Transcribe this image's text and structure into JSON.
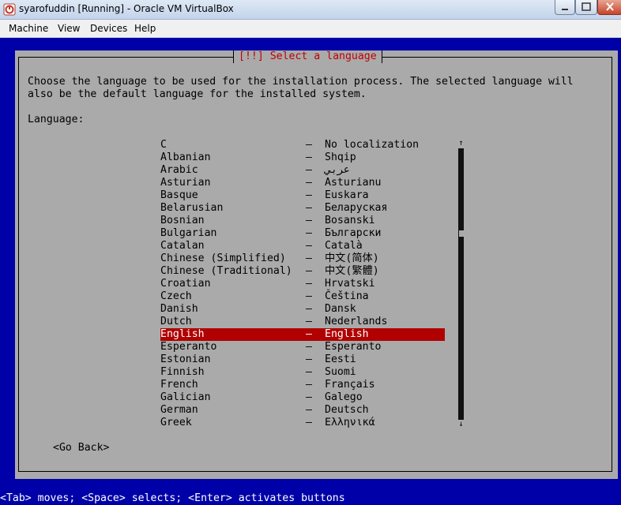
{
  "window": {
    "title": "syarofuddin [Running] - Oracle VM VirtualBox",
    "app_icon": "virtualbox-icon"
  },
  "menubar": {
    "items": [
      "Machine",
      "View",
      "Devices",
      "Help"
    ]
  },
  "dialog": {
    "title": "[!!] Select a language",
    "intro_line1": "Choose the language to be used for the installation process. The selected language will",
    "intro_line2": "also be the default language for the installed system.",
    "language_label": "Language:",
    "selected_index": 15,
    "languages": [
      {
        "name": "C",
        "native": "No localization"
      },
      {
        "name": "Albanian",
        "native": "Shqip"
      },
      {
        "name": "Arabic",
        "native": "عربي"
      },
      {
        "name": "Asturian",
        "native": "Asturianu"
      },
      {
        "name": "Basque",
        "native": "Euskara"
      },
      {
        "name": "Belarusian",
        "native": "Беларуская"
      },
      {
        "name": "Bosnian",
        "native": "Bosanski"
      },
      {
        "name": "Bulgarian",
        "native": "Български"
      },
      {
        "name": "Catalan",
        "native": "Català"
      },
      {
        "name": "Chinese (Simplified)",
        "native": "中文(简体)"
      },
      {
        "name": "Chinese (Traditional)",
        "native": "中文(繁體)"
      },
      {
        "name": "Croatian",
        "native": "Hrvatski"
      },
      {
        "name": "Czech",
        "native": "Čeština"
      },
      {
        "name": "Danish",
        "native": "Dansk"
      },
      {
        "name": "Dutch",
        "native": "Nederlands"
      },
      {
        "name": "English",
        "native": "English"
      },
      {
        "name": "Esperanto",
        "native": "Esperanto"
      },
      {
        "name": "Estonian",
        "native": "Eesti"
      },
      {
        "name": "Finnish",
        "native": "Suomi"
      },
      {
        "name": "French",
        "native": "Français"
      },
      {
        "name": "Galician",
        "native": "Galego"
      },
      {
        "name": "German",
        "native": "Deutsch"
      },
      {
        "name": "Greek",
        "native": "Ελληνικά"
      }
    ],
    "separator": "–",
    "scroll_up": "↑",
    "scroll_down": "↓",
    "go_back": "<Go Back>"
  },
  "status_bar": "<Tab> moves; <Space> selects; <Enter> activates buttons",
  "colors": {
    "vm_background": "#0000a8",
    "dialog_gray": "#aaaaaa",
    "title_red": "#c00000",
    "selection": "#b00000"
  }
}
